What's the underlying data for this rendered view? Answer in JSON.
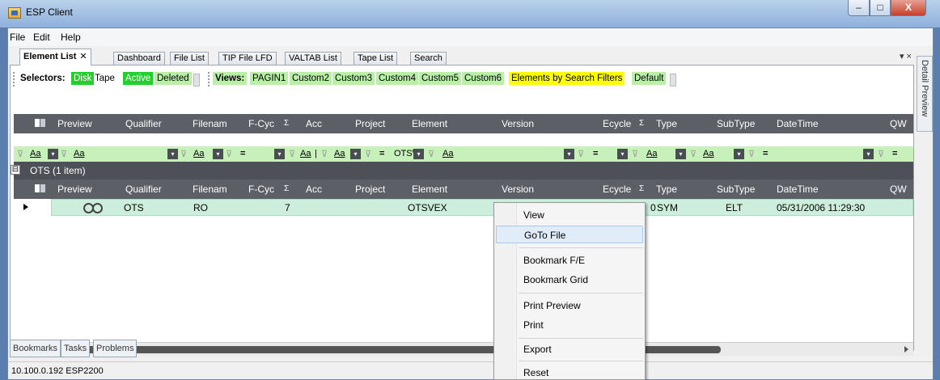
{
  "window": {
    "title": "ESP Client",
    "min": "–",
    "max": "□",
    "close": "X"
  },
  "menu": [
    "File",
    "Edit",
    "Help"
  ],
  "tabs": [
    {
      "label": "Element List",
      "close": "✕"
    },
    {
      "label": "Dashboard"
    },
    {
      "label": "File List"
    },
    {
      "label": "TIP File LFD"
    },
    {
      "label": "VALTAB List"
    },
    {
      "label": "Tape List"
    },
    {
      "label": "Search"
    }
  ],
  "tab_controls": "▾ ×",
  "detail_preview": "Detail Preview",
  "selectors": {
    "label": "Selectors:",
    "items": [
      "Disk",
      "Tape",
      "Active",
      "Deleted"
    ],
    "views_label": "Views:",
    "views": [
      "PAGIN1",
      "Custom2",
      "Custom3",
      "Custom4",
      "Custom5",
      "Custom6"
    ],
    "highlight": "Elements by Search Filters",
    "default": "Default"
  },
  "columns": [
    "Preview",
    "Qualifier",
    "Filenam",
    "F-Cyc",
    "Σ",
    "Acc",
    "Project",
    "Element",
    "Version",
    "Ecycle",
    "Σ",
    "Type",
    "SubType",
    "DateTime",
    "QW"
  ],
  "filter": {
    "aa": "Aa",
    "dd": "▾",
    "funnel": "⊽",
    "eq": "=",
    "element_filter": "OTS\\",
    "pipe": "|",
    "clear": "ₓ"
  },
  "group": {
    "expander": "⊟",
    "label": "OTS (1 item)"
  },
  "row": {
    "qualifier": "OTS",
    "filename": "RO",
    "fcycle": "7",
    "element": "OTSVEX",
    "ecycle_partial": "0",
    "type": "SYM",
    "subtype": "ELT",
    "datetime": "05/31/2006 11:29:30"
  },
  "context_menu": [
    "View",
    "GoTo File",
    "Bookmark F/E",
    "Bookmark Grid",
    "Print Preview",
    "Print",
    "Export",
    "Reset"
  ],
  "bottom_tabs": [
    "Bookmarks",
    "Tasks",
    "Problems"
  ],
  "status": "10.100.0.192  ESP2200"
}
